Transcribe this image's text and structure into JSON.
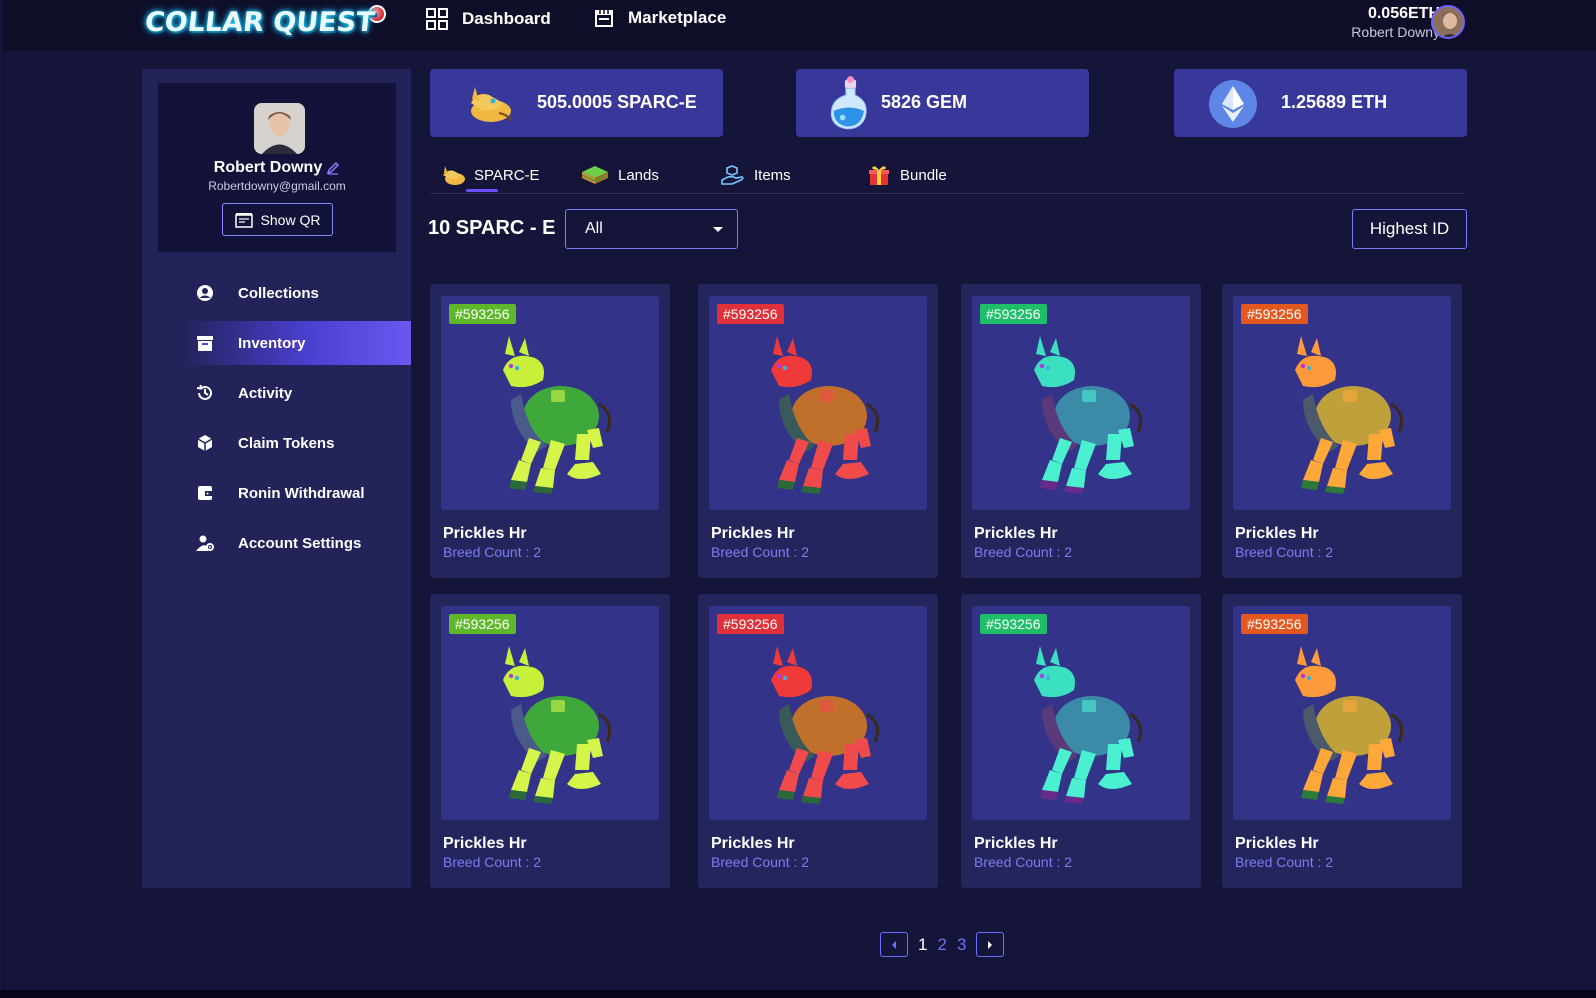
{
  "header": {
    "logo_text": "COLLAR QUEST",
    "nav": [
      {
        "label": "Dashboard",
        "icon": "grid-icon"
      },
      {
        "label": "Marketplace",
        "icon": "store-icon"
      }
    ],
    "eth_balance": "0.056ETH",
    "user_name": "Robert Downy"
  },
  "profile": {
    "name": "Robert Downy",
    "email": "Robertdowny@gmail.com",
    "show_qr_label": "Show QR"
  },
  "sidebar": {
    "items": [
      {
        "label": "Collections",
        "icon": "user-circle-icon",
        "active": false
      },
      {
        "label": "Inventory",
        "icon": "archive-box-icon",
        "active": true
      },
      {
        "label": "Activity",
        "icon": "history-icon",
        "active": false
      },
      {
        "label": "Claim Tokens",
        "icon": "cube-icon",
        "active": false
      },
      {
        "label": "Ronin Withdrawal",
        "icon": "wallet-icon",
        "active": false
      },
      {
        "label": "Account Settings",
        "icon": "user-gear-icon",
        "active": false
      }
    ]
  },
  "balances": [
    {
      "label": "505.0005 SPARC-E",
      "icon": "sparce-dog-icon"
    },
    {
      "label": "5826 GEM",
      "icon": "potion-icon"
    },
    {
      "label": "1.25689 ETH",
      "icon": "ethereum-icon"
    }
  ],
  "tabs": [
    {
      "label": "SPARC-E",
      "icon": "sparce-dog-icon",
      "active": true
    },
    {
      "label": "Lands",
      "icon": "land-tile-icon",
      "active": false
    },
    {
      "label": "Items",
      "icon": "hand-item-icon",
      "active": false
    },
    {
      "label": "Bundle",
      "icon": "gift-icon",
      "active": false
    }
  ],
  "filter": {
    "count_label": "10 SPARC - E",
    "select_value": "All",
    "sort_label": "Highest ID"
  },
  "cards": [
    {
      "id": "#593256",
      "name": "Prickles Hr",
      "breed": "Breed Count : 2",
      "color": "green",
      "tag_color": "#5fb82a"
    },
    {
      "id": "#593256",
      "name": "Prickles Hr",
      "breed": "Breed Count : 2",
      "color": "red",
      "tag_color": "#e0303a"
    },
    {
      "id": "#593256",
      "name": "Prickles Hr",
      "breed": "Breed Count : 2",
      "color": "teal",
      "tag_color": "#1fbf6a"
    },
    {
      "id": "#593256",
      "name": "Prickles Hr",
      "breed": "Breed Count : 2",
      "color": "orange",
      "tag_color": "#e2581e"
    },
    {
      "id": "#593256",
      "name": "Prickles Hr",
      "breed": "Breed Count : 2",
      "color": "green",
      "tag_color": "#5fb82a"
    },
    {
      "id": "#593256",
      "name": "Prickles Hr",
      "breed": "Breed Count : 2",
      "color": "red",
      "tag_color": "#e0303a"
    },
    {
      "id": "#593256",
      "name": "Prickles Hr",
      "breed": "Breed Count : 2",
      "color": "teal",
      "tag_color": "#1fbf6a"
    },
    {
      "id": "#593256",
      "name": "Prickles Hr",
      "breed": "Breed Count : 2",
      "color": "orange",
      "tag_color": "#e2581e"
    }
  ],
  "pagination": {
    "pages": [
      "1",
      "2",
      "3"
    ],
    "current": "1"
  },
  "colors": {
    "background": "#15153a",
    "panel": "#23235a",
    "balance_card": "#38389a",
    "accent": "#6c4cff",
    "breed_text": "#7f7af0"
  }
}
